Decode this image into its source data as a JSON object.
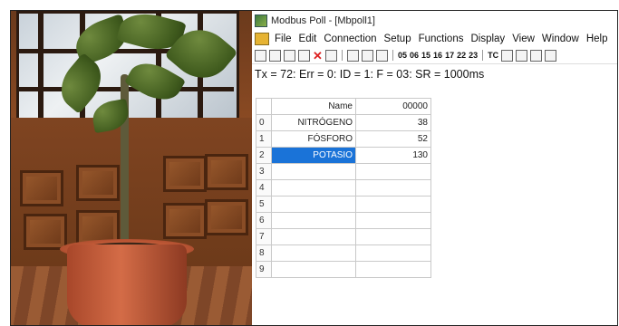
{
  "app": {
    "title": "Modbus Poll - [Mbpoll1]",
    "menu": [
      "File",
      "Edit",
      "Connection",
      "Setup",
      "Functions",
      "Display",
      "View",
      "Window",
      "Help"
    ],
    "toolbar_codes": [
      "05",
      "06",
      "15",
      "16",
      "17",
      "22",
      "23",
      "TC"
    ],
    "status_line": "Tx = 72: Err = 0: ID = 1: F = 03: SR = 1000ms"
  },
  "grid": {
    "header_name": "Name",
    "header_value": "00000",
    "rows": [
      {
        "index": "0",
        "name": "NITRÓGENO",
        "value": "38"
      },
      {
        "index": "1",
        "name": "FÓSFORO",
        "value": "52"
      },
      {
        "index": "2",
        "name": "POTASIO",
        "value": "130"
      },
      {
        "index": "3",
        "name": "",
        "value": ""
      },
      {
        "index": "4",
        "name": "",
        "value": ""
      },
      {
        "index": "5",
        "name": "",
        "value": ""
      },
      {
        "index": "6",
        "name": "",
        "value": ""
      },
      {
        "index": "7",
        "name": "",
        "value": ""
      },
      {
        "index": "8",
        "name": "",
        "value": ""
      },
      {
        "index": "9",
        "name": "",
        "value": ""
      }
    ],
    "selected_row": 2
  },
  "colors": {
    "selection": "#1a73d8"
  }
}
